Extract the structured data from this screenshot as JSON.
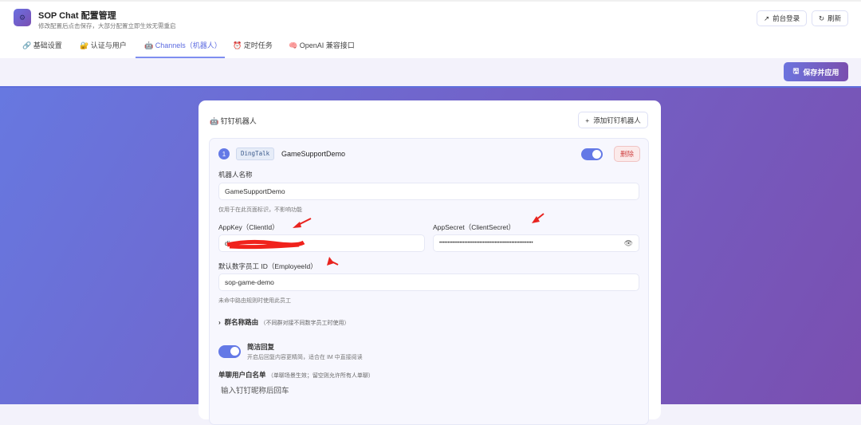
{
  "header": {
    "title": "SOP Chat 配置管理",
    "subtitle": "修改配置后点击保存，大部分配置立即生效无需重启",
    "frontend_login": "前台登录",
    "refresh": "刷新"
  },
  "tabs": [
    {
      "icon": "🔗",
      "label": "基础设置"
    },
    {
      "icon": "🔐",
      "label": "认证与用户"
    },
    {
      "icon": "🤖",
      "label": "Channels（机器人）"
    },
    {
      "icon": "⏰",
      "label": "定时任务"
    },
    {
      "icon": "🧠",
      "label": "OpenAI 兼容接口"
    }
  ],
  "toolbar": {
    "save_label": "保存并应用"
  },
  "section": {
    "icon": "🤖",
    "title": "钉钉机器人",
    "add_label": "添加钉钉机器人"
  },
  "bot": {
    "index": "1",
    "platform": "DingTalk",
    "name": "GameSupportDemo",
    "enabled": true,
    "delete_label": "删除",
    "name_label": "机器人名称",
    "name_value": "GameSupportDemo",
    "name_hint": "仅用于在此页面标识，不影响功能",
    "appkey_label": "AppKey（ClientId）",
    "appkey_value": "ding",
    "appsecret_label": "AppSecret（ClientSecret）",
    "appsecret_value": "••••••••••••••••••••••••••••••••••••••••••••••••••••••••",
    "employee_label": "默认数字员工 ID（EmployeeId）",
    "employee_value": "sop-game-demo",
    "employee_hint": "未命中路由规则时使用此员工",
    "group_route_label": "群名称路由",
    "group_route_note": "（不同群对接不同数字员工时使用）",
    "concise_label": "简洁回复",
    "concise_desc": "开启后回复内容更精简，适合在 IM 中直接阅读",
    "concise_enabled": true,
    "whitelist_label": "单聊用户白名单",
    "whitelist_note": "（单聊场景生效；留空则允许所有人单聊）",
    "whitelist_placeholder": "输入钉钉昵称后回车"
  },
  "colors": {
    "accent": "#6479e6",
    "danger": "#d04545",
    "annotation": "#e8231f"
  }
}
